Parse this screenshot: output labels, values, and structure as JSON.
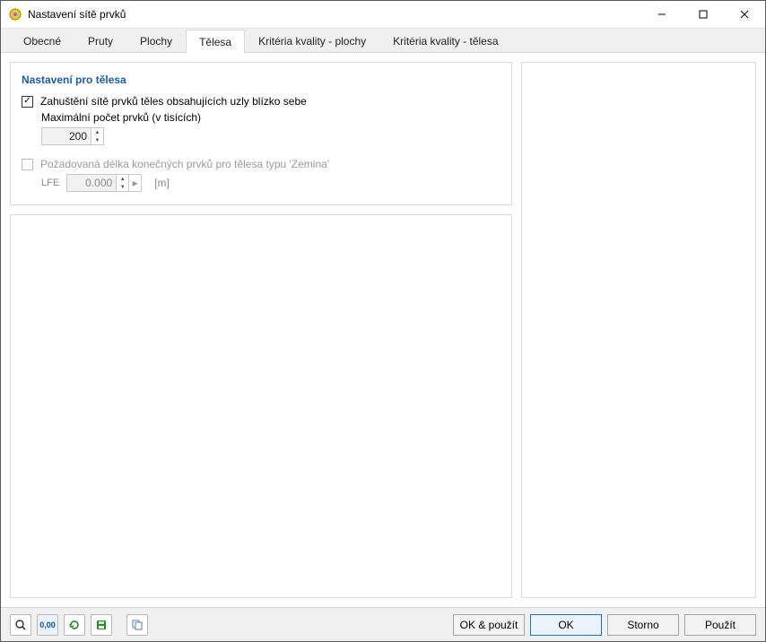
{
  "window": {
    "title": "Nastavení sítě prvků"
  },
  "tabs": {
    "obecne": "Obecné",
    "pruty": "Pruty",
    "plochy": "Plochy",
    "telesa": "Tělesa",
    "kvalita_plochy": "Kritéria kvality - plochy",
    "kvalita_telesa": "Kritéria kvality - tělesa"
  },
  "panel": {
    "heading": "Nastavení pro tělesa",
    "refine_label": "Zahuštění sítě prvků těles obsahujících uzly blízko sebe",
    "max_label": "Maximální počet prvků (v tisících)",
    "max_value": "200",
    "target_label": "Požadovaná délka konečných prvků pro tělesa typu 'Zemina'",
    "lfe_symbol": "LFE",
    "lfe_value": "0.000",
    "lfe_unit": "[m]"
  },
  "footer": {
    "ok_apply": "OK & použít",
    "ok": "OK",
    "cancel": "Storno",
    "apply": "Použít"
  }
}
